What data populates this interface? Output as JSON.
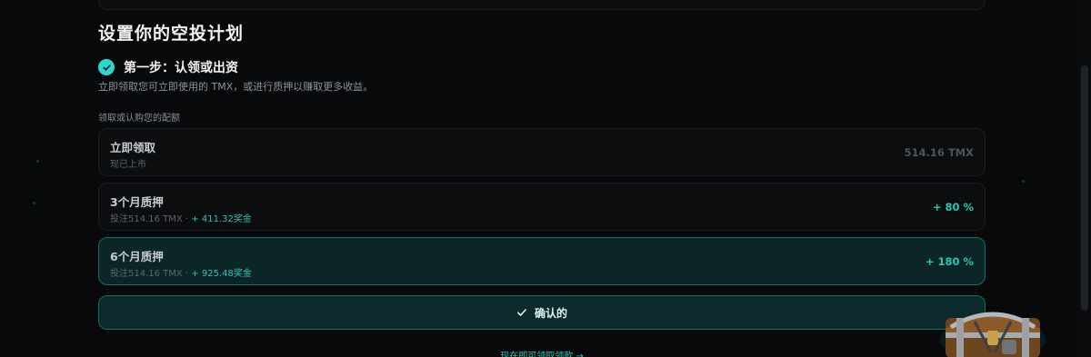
{
  "section": {
    "title": "设置你的空投计划"
  },
  "step": {
    "title": "第一步：认领或出资",
    "description": "立即领取您可立即使用的 TMX，或进行质押以赚取更多收益。"
  },
  "allocation_label": "领取或认购您的配额",
  "options": [
    {
      "title": "立即领取",
      "subtitle": "现已上市",
      "right": "514.16 TMX",
      "selected": false
    },
    {
      "title": "3个月质押",
      "subtitle_prefix": "投注514.16 TMX ·",
      "bonus": "+ 411.32奖金",
      "right": "+ 80 %",
      "selected": false
    },
    {
      "title": "6个月质押",
      "subtitle_prefix": "投注514.16 TMX ·",
      "bonus": "+ 925.48奖金",
      "right": "+ 180 %",
      "selected": true
    }
  ],
  "confirm_label": "确认的",
  "claim_link": "现在即可领取领款 →",
  "colors": {
    "background": "#08090b",
    "accent": "#2ec4b6",
    "selected_bg": "#0c2527",
    "check_badge": "#2fd6d0"
  },
  "icons": {
    "step_check": "check-circle-icon",
    "confirm_check": "check-icon",
    "treasure_chest": "treasure-chest-icon"
  }
}
